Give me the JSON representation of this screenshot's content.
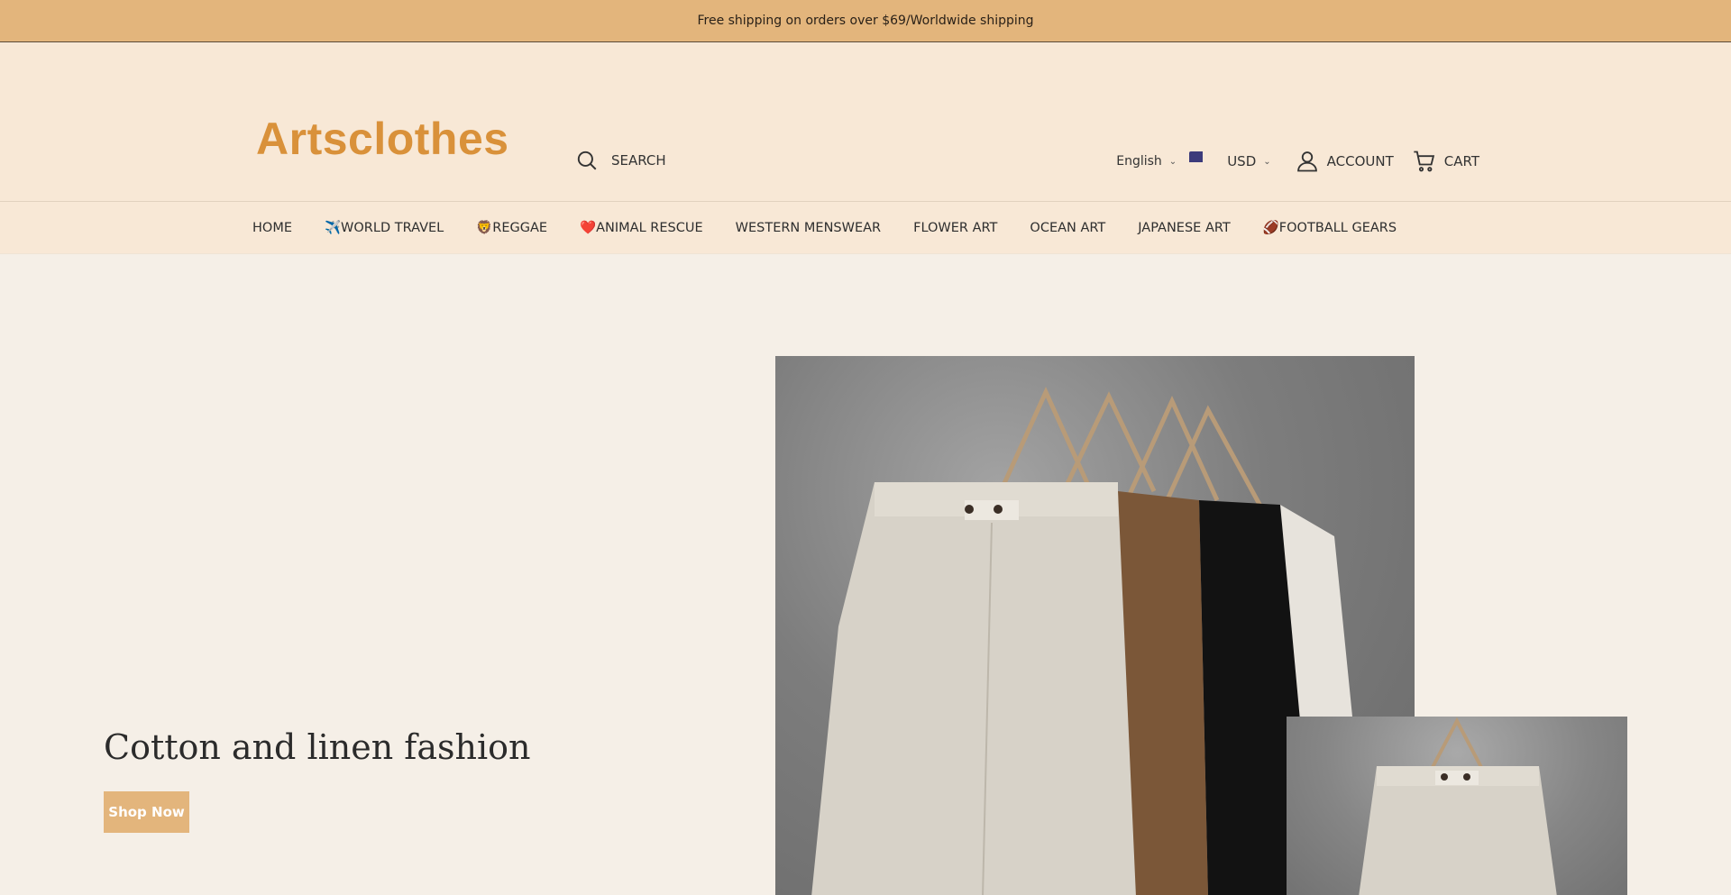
{
  "announcement": {
    "text": "Free shipping on orders over $69/Worldwide shipping"
  },
  "header": {
    "logo_text": "Artsclothes",
    "search_label": "SEARCH",
    "language": "English",
    "currency": "USD",
    "account_label": "ACCOUNT",
    "cart_label": "CART"
  },
  "nav": {
    "items": [
      {
        "label": "HOME"
      },
      {
        "label": "✈️WORLD TRAVEL"
      },
      {
        "label": "🦁REGGAE"
      },
      {
        "label": "❤️ANIMAL RESCUE"
      },
      {
        "label": "WESTERN MENSWEAR"
      },
      {
        "label": "FLOWER ART"
      },
      {
        "label": "OCEAN ART"
      },
      {
        "label": "JAPANESE ART"
      },
      {
        "label": "🏈FOOTBALL GEARS"
      }
    ]
  },
  "hero": {
    "title": "Cotton and linen fashion",
    "button_label": "Shop Now",
    "main_image": "linen-pants-on-hangers",
    "secondary_image": "linen-pants-closeup"
  },
  "colors": {
    "accent": "#e3b57c",
    "header_bg": "#f8e8d6",
    "page_bg": "#f5efe7",
    "logo": "#d9913a"
  },
  "icons": {
    "search": "search-icon",
    "language_dropdown": "chevron-down-icon",
    "currency_flag": "us-flag-icon",
    "account": "user-icon",
    "cart": "cart-icon"
  }
}
